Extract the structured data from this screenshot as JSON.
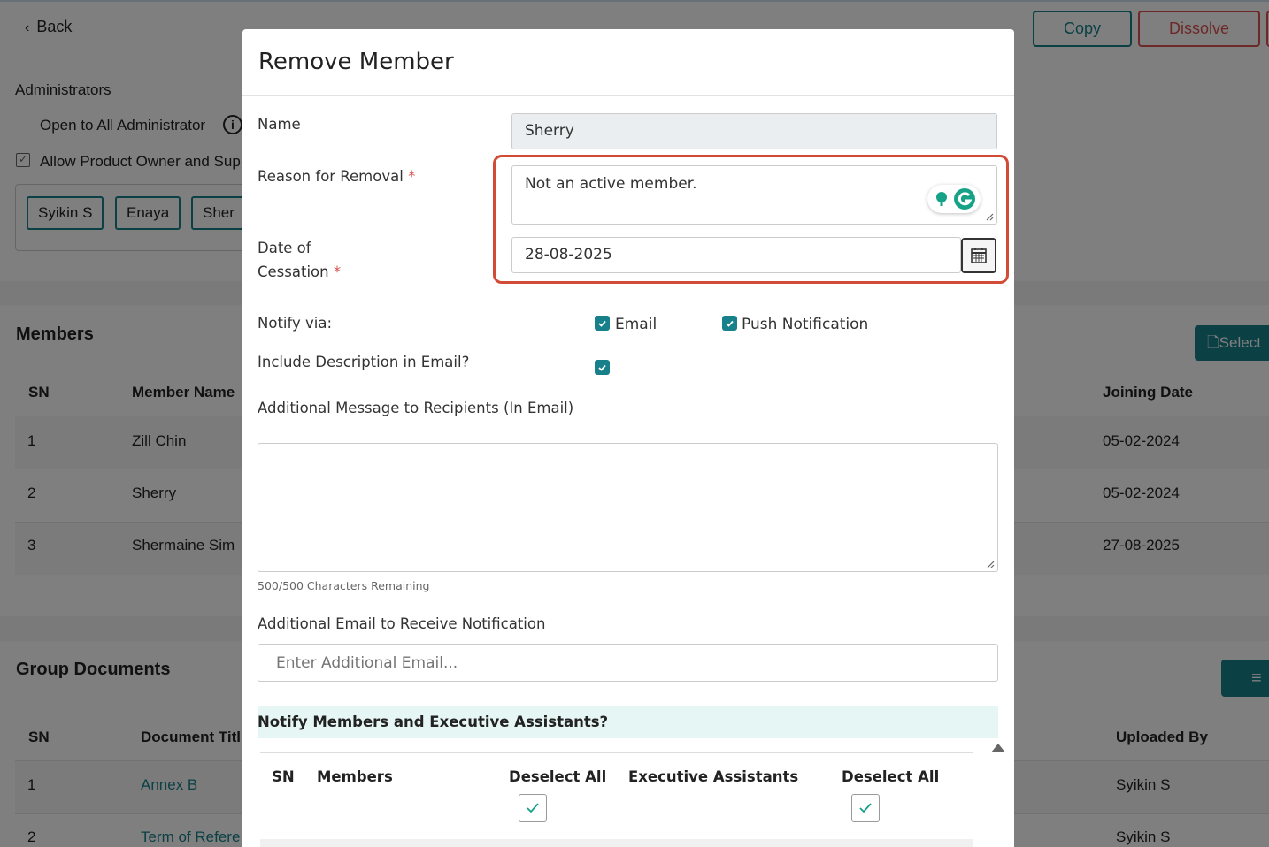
{
  "header": {
    "back_label": "Back",
    "copy_label": "Copy",
    "dissolve_label": "Dissolve"
  },
  "administrators": {
    "title": "Administrators",
    "open_to_all": "Open to All Administrator",
    "allow_text": "Allow Product Owner and Sup",
    "chips": [
      "Syikin S",
      "Enaya",
      "Sher"
    ]
  },
  "members": {
    "title": "Members",
    "select_label": "Select",
    "columns": {
      "sn": "SN",
      "member_name": "Member Name",
      "joining_date": "Joining Date"
    },
    "rows": [
      {
        "sn": "1",
        "name": "Zill Chin",
        "joining_date": "05-02-2024"
      },
      {
        "sn": "2",
        "name": "Sherry",
        "joining_date": "05-02-2024"
      },
      {
        "sn": "3",
        "name": "Shermaine Sim",
        "joining_date": "27-08-2025"
      }
    ]
  },
  "group_documents": {
    "title": "Group Documents",
    "columns": {
      "sn": "SN",
      "document_title": "Document Titl",
      "uploaded_by": "Uploaded By"
    },
    "rows": [
      {
        "sn": "1",
        "title": "Annex B",
        "uploaded_by": "Syikin S"
      },
      {
        "sn": "2",
        "title": "Term of Refere",
        "uploaded_by": "Syikin S"
      }
    ]
  },
  "modal": {
    "title": "Remove Member",
    "name_label": "Name",
    "name_value": "Sherry",
    "reason_label": "Reason for Removal",
    "reason_value": "Not an active member.",
    "date_label_line1": "Date of",
    "date_label_line2": "Cessation",
    "date_value": "28-08-2025",
    "required_mark": "*",
    "notify_label": "Notify via:",
    "email_option": "Email",
    "push_option": "Push Notification",
    "include_desc_label": "Include Description in Email?",
    "additional_message_label": "Additional Message to Recipients (In Email)",
    "additional_message_value": "",
    "chars_remaining": "500/500 Characters Remaining",
    "additional_email_label": "Additional Email to Receive Notification",
    "additional_email_placeholder": "Enter Additional Email...",
    "notify_section_title": "Notify Members and Executive Assistants?",
    "table": {
      "sn": "SN",
      "members": "Members",
      "deselect_all_members": "Deselect All",
      "executive_assistants": "Executive Assistants",
      "deselect_all_ea": "Deselect All"
    },
    "accent_color": "#17808a",
    "highlight_color": "#d14b37"
  }
}
